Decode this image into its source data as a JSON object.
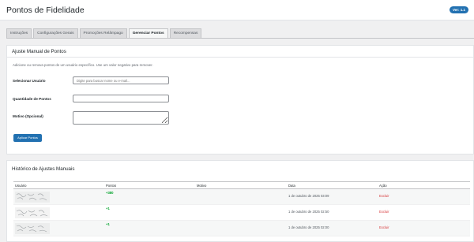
{
  "header": {
    "title": "Pontos de Fidelidade",
    "version": "Ver: 1.1"
  },
  "tabs": [
    {
      "label": "Instruções",
      "active": false
    },
    {
      "label": "Configurações Gerais",
      "active": false
    },
    {
      "label": "Promoções Relâmpago",
      "active": false
    },
    {
      "label": "Gerenciar Pontos",
      "active": true
    },
    {
      "label": "Recompensas",
      "active": false
    }
  ],
  "adjust": {
    "title": "Ajuste Manual de Pontos",
    "description": "Adicione ou remova pontos de um usuário específico. Use um valor negativo para remover.",
    "user_label": "Selecionar Usuário",
    "user_placeholder": "Digite para buscar nome ou e-mail...",
    "points_label": "Quantidade de Pontos",
    "points_value": "",
    "reason_label": "Motivo (Opcional)",
    "reason_value": "",
    "apply_label": "Aplicar Pontos"
  },
  "history": {
    "title": "Histórico de Ajustes Manuais",
    "columns": [
      "Usuário",
      "Pontos",
      "Motivo",
      "Data",
      "Ação"
    ],
    "rows": [
      {
        "points": "+380",
        "reason": "",
        "date": "1 de outubro de 2025 03:09",
        "action": "Excluir"
      },
      {
        "points": "+1",
        "reason": "",
        "date": "1 de outubro de 2025 02:50",
        "action": "Excluir"
      },
      {
        "points": "+1",
        "reason": "",
        "date": "1 de outubro de 2025 02:00",
        "action": "Excluir"
      }
    ]
  },
  "colors": {
    "accent": "#2271b1",
    "positive": "#00a32a",
    "danger": "#d63638"
  }
}
